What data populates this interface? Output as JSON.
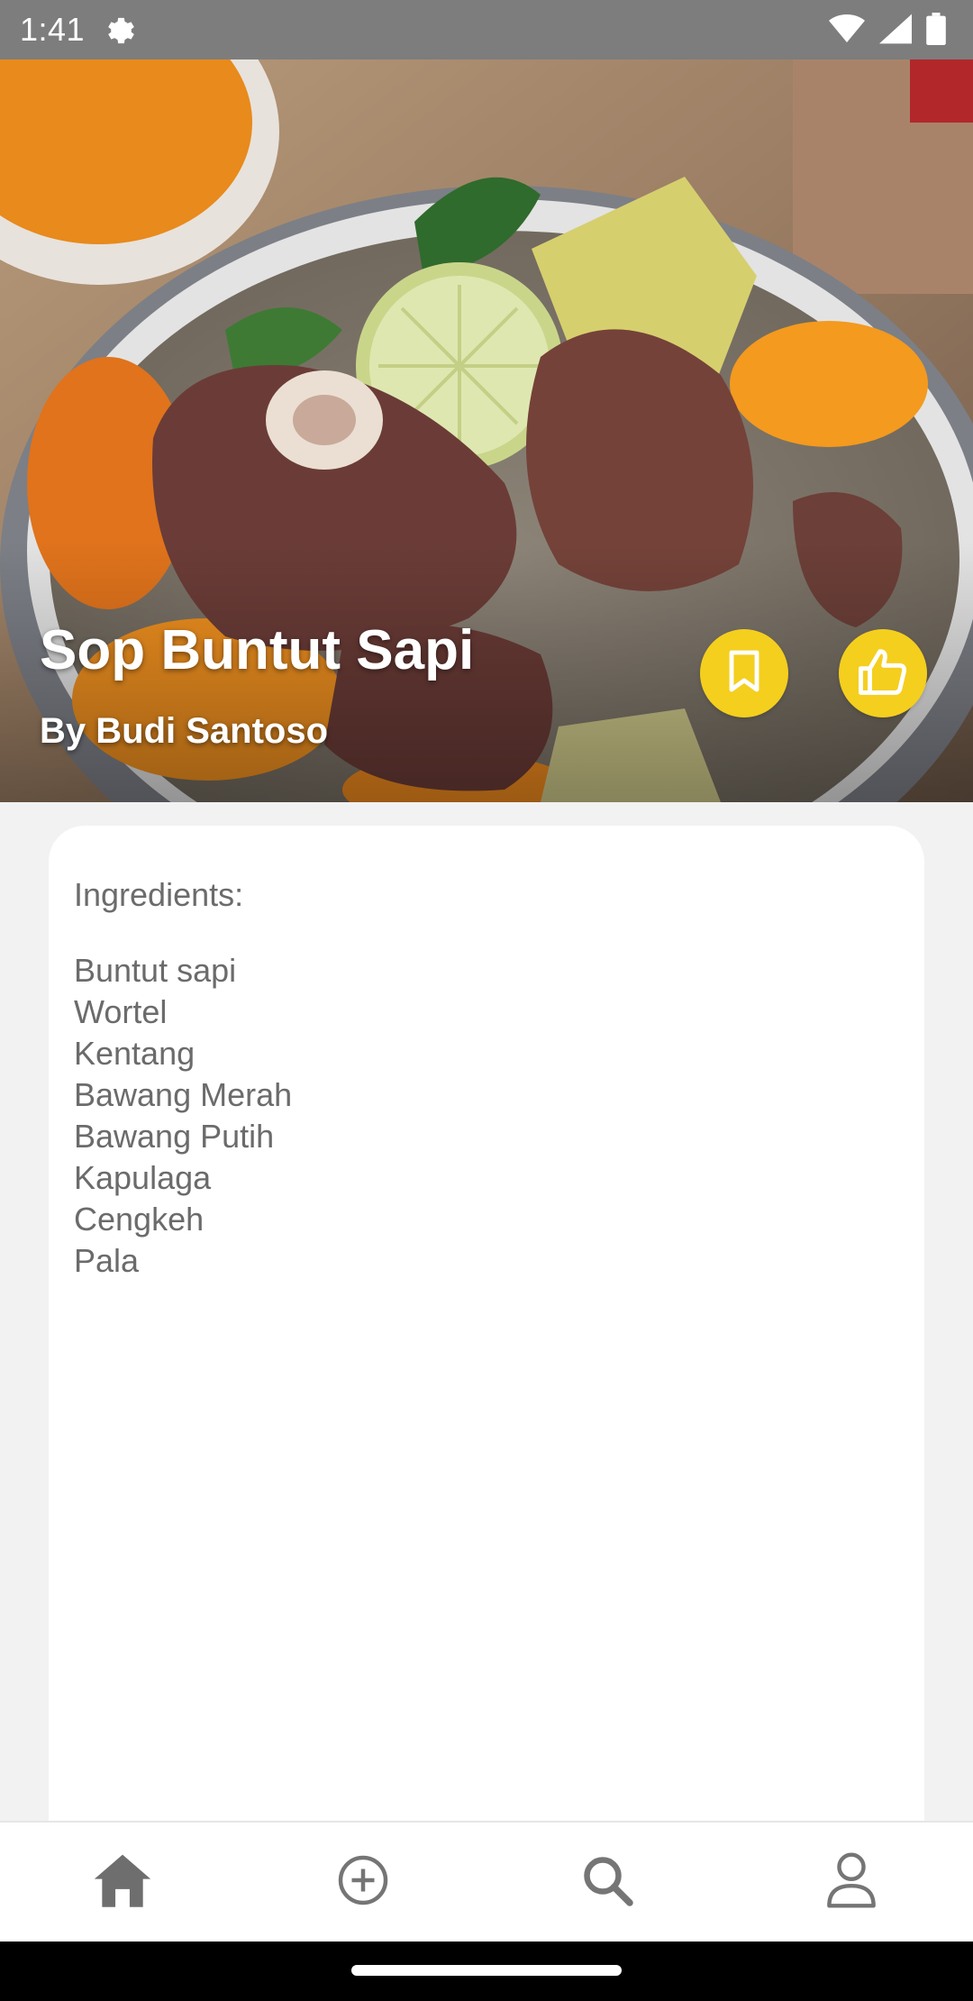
{
  "status_bar": {
    "time": "1:41",
    "icons": [
      "settings-icon",
      "wifi-icon",
      "signal-icon",
      "battery-icon"
    ]
  },
  "recipe": {
    "title": "Sop Buntut Sapi",
    "author": "By Budi Santoso",
    "photo": "oxtail-soup-photo"
  },
  "actions": {
    "bookmark_icon": "bookmark-icon",
    "like_icon": "thumbs-up-icon",
    "accent_color": "#f4cf1e"
  },
  "ingredients": {
    "heading": "Ingredients:",
    "items": [
      "Buntut sapi",
      "Wortel",
      "Kentang",
      "Bawang Merah",
      "Bawang Putih",
      "Kapulaga",
      "Cengkeh",
      "Pala"
    ]
  },
  "bottom_nav": {
    "items": [
      {
        "icon": "home-icon",
        "active": true
      },
      {
        "icon": "add-circle-icon",
        "active": false
      },
      {
        "icon": "search-icon",
        "active": false
      },
      {
        "icon": "profile-icon",
        "active": false
      }
    ],
    "active_color": "#6e6e6e",
    "inactive_color": "#757575"
  }
}
